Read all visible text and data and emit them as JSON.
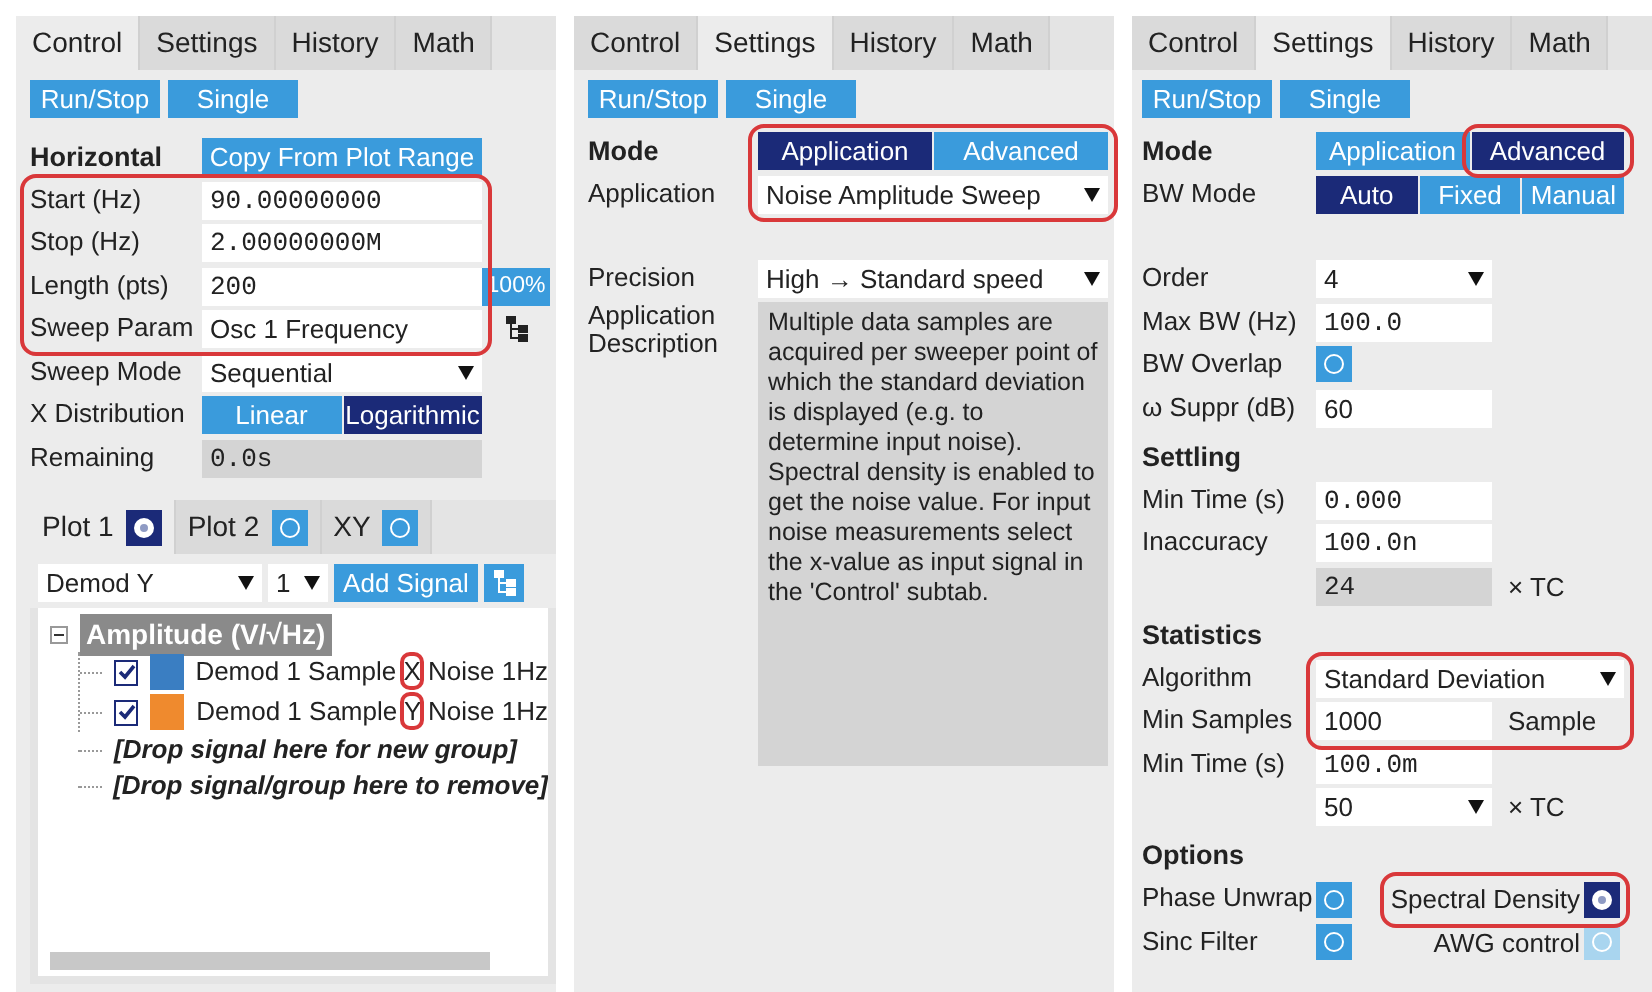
{
  "panels": [
    {
      "kind": "control",
      "tabs": [
        {
          "label": "Control",
          "selected": true
        },
        {
          "label": "Settings",
          "selected": false
        },
        {
          "label": "History",
          "selected": false
        },
        {
          "label": "Math",
          "selected": false
        }
      ],
      "actions": [
        "Run/Stop",
        "Single"
      ],
      "rows": [
        {
          "kind": "heading",
          "label": "Horizontal",
          "button": "Copy From Plot Range"
        },
        {
          "kind": "number",
          "label": "Start (Hz)",
          "value": "90.00000000",
          "highlighted": true
        },
        {
          "kind": "number",
          "label": "Stop (Hz)",
          "value": "2.00000000M",
          "highlighted": true
        },
        {
          "kind": "number",
          "label": "Length (pts)",
          "value": "200",
          "highlighted": true,
          "side_button": "100%"
        },
        {
          "kind": "text",
          "label": "Sweep Param",
          "value": "Osc 1 Frequency",
          "highlighted": true,
          "tree_button": true
        },
        {
          "kind": "select",
          "label": "Sweep Mode",
          "value": "Sequential"
        },
        {
          "kind": "segmented",
          "label": "X Distribution",
          "options": [
            {
              "label": "Linear",
              "selected": false
            },
            {
              "label": "Logarithmic",
              "selected": true
            }
          ]
        },
        {
          "kind": "readonly",
          "label": "Remaining",
          "value": "0.0s"
        }
      ],
      "plots": {
        "tabs": [
          {
            "label": "Plot 1",
            "selected": true,
            "on": true
          },
          {
            "label": "Plot 2",
            "selected": false,
            "on": false
          },
          {
            "label": "XY",
            "selected": false,
            "on": false
          }
        ],
        "signal_select": "Demod Y",
        "index_select": "1",
        "add_button": "Add Signal",
        "tree": [
          {
            "label": "Amplitude (V/√Hz)",
            "expanded": true,
            "children": [
              {
                "checked": true,
                "color": "#3a7ec2",
                "name": "Demod 1 Sample",
                "channel": "X",
                "suffix": "Noise 1Hz",
                "channel_highlighted": true
              },
              {
                "checked": true,
                "color": "#ef8a2e",
                "name": "Demod 1 Sample",
                "channel": "Y",
                "suffix": "Noise 1Hz",
                "channel_highlighted": true
              }
            ]
          }
        ],
        "drop_hints": [
          "[Drop signal here for new group]",
          "[Drop signal/group here to remove]"
        ]
      }
    },
    {
      "kind": "settings",
      "tabs": [
        {
          "label": "Control",
          "selected": false
        },
        {
          "label": "Settings",
          "selected": true
        },
        {
          "label": "History",
          "selected": false
        },
        {
          "label": "Math",
          "selected": false
        }
      ],
      "actions": [
        "Run/Stop",
        "Single"
      ],
      "rows": [
        {
          "kind": "mode",
          "label": "Mode",
          "highlighted": true,
          "options": [
            {
              "label": "Application",
              "selected": true
            },
            {
              "label": "Advanced",
              "selected": false
            }
          ]
        },
        {
          "kind": "wide_select",
          "label": "Application",
          "value": "Noise Amplitude Sweep",
          "highlighted": true
        },
        {
          "kind": "wide_select",
          "label": "Precision",
          "value": "High → Standard speed",
          "spaced": true
        },
        {
          "kind": "description",
          "label": "Application Description",
          "text": "Multiple data samples are acquired per sweeper point of which the standard deviation is displayed (e.g. to determine input noise). Spectral density is enabled to get the noise value. For input noise measurements select the x-value as input signal in the 'Control' subtab."
        }
      ]
    },
    {
      "kind": "advanced",
      "tabs": [
        {
          "label": "Control",
          "selected": false
        },
        {
          "label": "Settings",
          "selected": true
        },
        {
          "label": "History",
          "selected": false
        },
        {
          "label": "Math",
          "selected": false
        }
      ],
      "actions": [
        "Run/Stop",
        "Single"
      ],
      "rows": [
        {
          "kind": "mode",
          "label": "Mode",
          "options": [
            {
              "label": "Application",
              "selected": false
            },
            {
              "label": "Advanced",
              "selected": true,
              "highlighted": true
            }
          ]
        },
        {
          "kind": "segmented",
          "label": "BW Mode",
          "options": [
            {
              "label": "Auto",
              "selected": true
            },
            {
              "label": "Fixed",
              "selected": false
            },
            {
              "label": "Manual",
              "selected": false
            }
          ]
        },
        {
          "kind": "select",
          "label": "Order",
          "value": "4",
          "spaced": true
        },
        {
          "kind": "number",
          "label": "Max BW (Hz)",
          "value": "100.0"
        },
        {
          "kind": "toggle",
          "label": "BW Overlap",
          "on": false
        },
        {
          "kind": "text",
          "label": "ω Suppr (dB)",
          "value": "60"
        },
        {
          "kind": "heading",
          "label": "Settling"
        },
        {
          "kind": "number",
          "label": "Min Time (s)",
          "value": "0.000"
        },
        {
          "kind": "number",
          "label": "Inaccuracy",
          "value": "100.0n"
        },
        {
          "kind": "readonly",
          "value": "24",
          "suffix": "× TC"
        },
        {
          "kind": "heading",
          "label": "Statistics"
        },
        {
          "kind": "wide_select",
          "label": "Algorithm",
          "value": "Standard Deviation",
          "highlighted": true
        },
        {
          "kind": "text",
          "label": "Min Samples",
          "value": "1000",
          "suffix": "Sample",
          "highlighted": true
        },
        {
          "kind": "number",
          "label": "Min Time (s)",
          "value": "100.0m"
        },
        {
          "kind": "select",
          "value": "50",
          "suffix": "× TC"
        },
        {
          "kind": "heading",
          "label": "Options"
        },
        {
          "kind": "toggle_pair",
          "items": [
            {
              "label": "Phase Unwrap",
              "on": false
            },
            {
              "label": "Spectral Density",
              "on": true,
              "highlighted": true
            }
          ]
        },
        {
          "kind": "toggle_pair",
          "items": [
            {
              "label": "Sinc Filter",
              "on": false
            },
            {
              "label": "AWG control",
              "on": false,
              "disabled": true
            }
          ]
        }
      ]
    }
  ]
}
